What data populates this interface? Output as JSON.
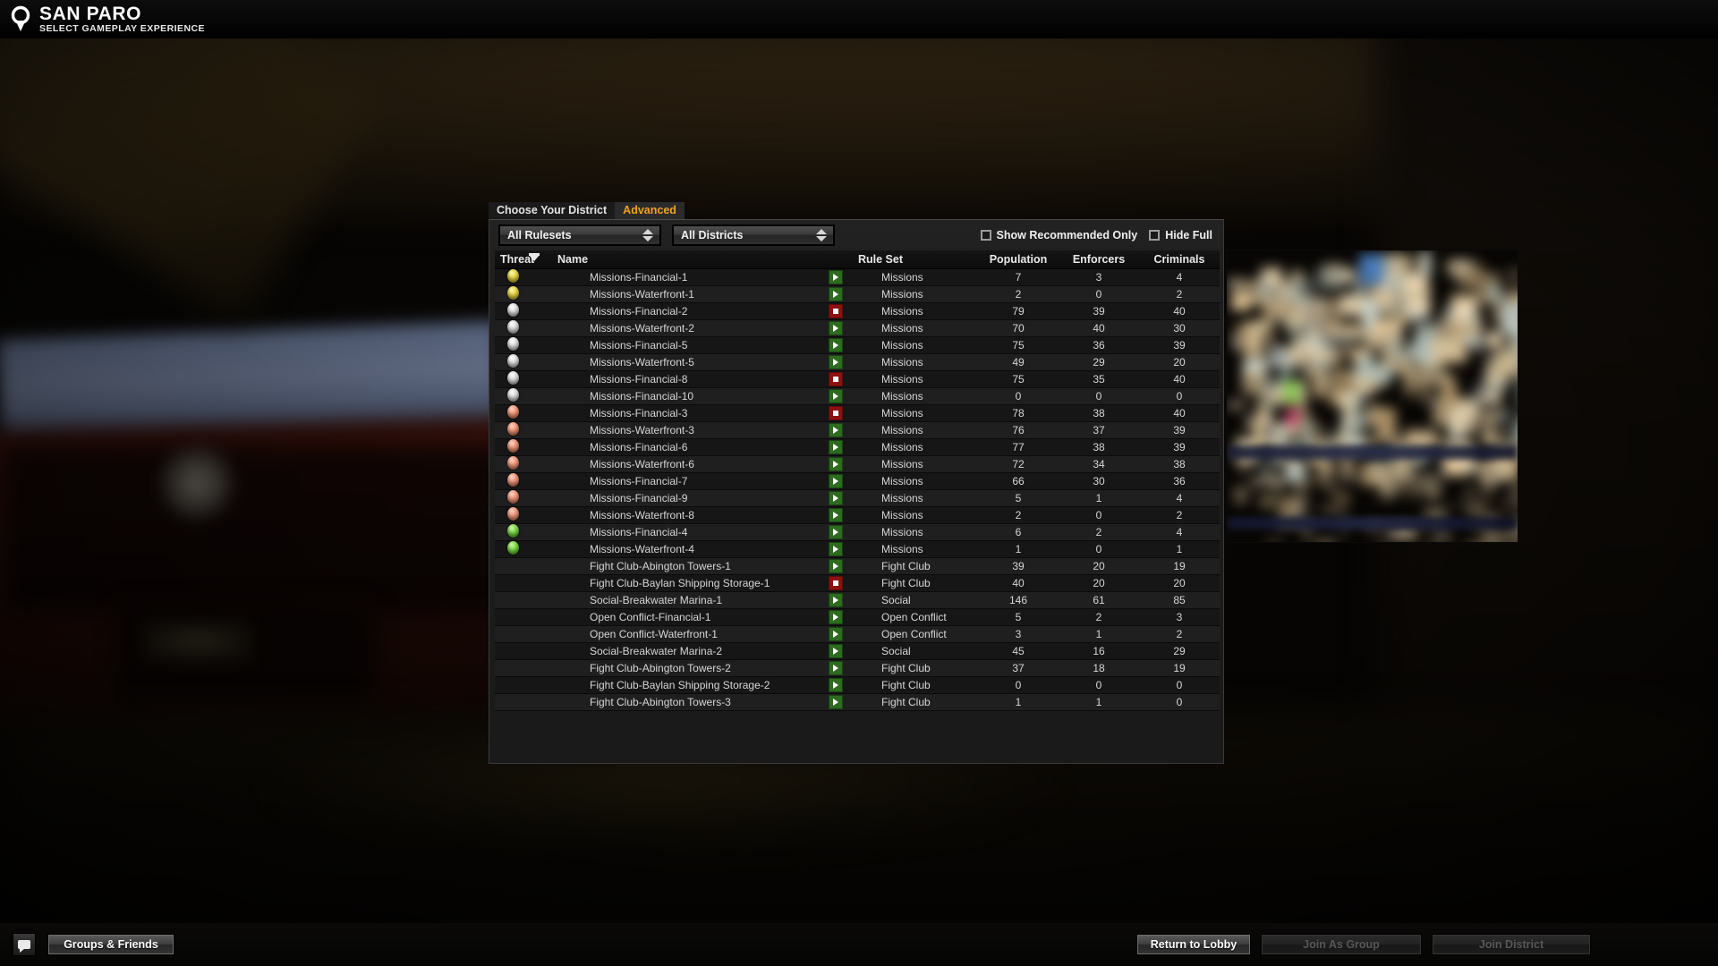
{
  "header": {
    "logo_icon": "magnifier-pin-icon",
    "title": "SAN PARO",
    "subtitle": "SELECT GAMEPLAY EXPERIENCE"
  },
  "panel": {
    "tabs": [
      {
        "label": "Choose Your District",
        "active": false
      },
      {
        "label": "Advanced",
        "active": true
      }
    ],
    "filters": {
      "ruleset_dropdown": {
        "name": "ruleset-filter",
        "value": "All Rulesets"
      },
      "district_dropdown": {
        "name": "district-filter",
        "value": "All Districts"
      }
    },
    "checkboxes": [
      {
        "label": "Show Recommended Only",
        "checked": false
      },
      {
        "label": "Hide Full",
        "checked": false
      }
    ],
    "table": {
      "columns": [
        "Threat",
        "Name",
        "",
        "Rule Set",
        "Population",
        "Enforcers",
        "Criminals"
      ],
      "sort_column": "Threat",
      "sort_direction": "descending",
      "rows": [
        {
          "threat": "gold",
          "name": "Missions-Financial-1",
          "status": "open",
          "rule_set": "Missions",
          "population": "7",
          "enforcers": "3",
          "criminals": "4"
        },
        {
          "threat": "gold",
          "name": "Missions-Waterfront-1",
          "status": "open",
          "rule_set": "Missions",
          "population": "2",
          "enforcers": "0",
          "criminals": "2"
        },
        {
          "threat": "silver",
          "name": "Missions-Financial-2",
          "status": "full",
          "rule_set": "Missions",
          "population": "79",
          "enforcers": "39",
          "criminals": "40"
        },
        {
          "threat": "silver",
          "name": "Missions-Waterfront-2",
          "status": "open",
          "rule_set": "Missions",
          "population": "70",
          "enforcers": "40",
          "criminals": "30"
        },
        {
          "threat": "silver",
          "name": "Missions-Financial-5",
          "status": "open",
          "rule_set": "Missions",
          "population": "75",
          "enforcers": "36",
          "criminals": "39"
        },
        {
          "threat": "silver",
          "name": "Missions-Waterfront-5",
          "status": "open",
          "rule_set": "Missions",
          "population": "49",
          "enforcers": "29",
          "criminals": "20"
        },
        {
          "threat": "silver",
          "name": "Missions-Financial-8",
          "status": "full",
          "rule_set": "Missions",
          "population": "75",
          "enforcers": "35",
          "criminals": "40"
        },
        {
          "threat": "silver",
          "name": "Missions-Financial-10",
          "status": "open",
          "rule_set": "Missions",
          "population": "0",
          "enforcers": "0",
          "criminals": "0"
        },
        {
          "threat": "salmon",
          "name": "Missions-Financial-3",
          "status": "full",
          "rule_set": "Missions",
          "population": "78",
          "enforcers": "38",
          "criminals": "40"
        },
        {
          "threat": "salmon",
          "name": "Missions-Waterfront-3",
          "status": "open",
          "rule_set": "Missions",
          "population": "76",
          "enforcers": "37",
          "criminals": "39"
        },
        {
          "threat": "salmon",
          "name": "Missions-Financial-6",
          "status": "open",
          "rule_set": "Missions",
          "population": "77",
          "enforcers": "38",
          "criminals": "39"
        },
        {
          "threat": "salmon",
          "name": "Missions-Waterfront-6",
          "status": "open",
          "rule_set": "Missions",
          "population": "72",
          "enforcers": "34",
          "criminals": "38"
        },
        {
          "threat": "salmon",
          "name": "Missions-Financial-7",
          "status": "open",
          "rule_set": "Missions",
          "population": "66",
          "enforcers": "30",
          "criminals": "36"
        },
        {
          "threat": "salmon",
          "name": "Missions-Financial-9",
          "status": "open",
          "rule_set": "Missions",
          "population": "5",
          "enforcers": "1",
          "criminals": "4"
        },
        {
          "threat": "salmon",
          "name": "Missions-Waterfront-8",
          "status": "open",
          "rule_set": "Missions",
          "population": "2",
          "enforcers": "0",
          "criminals": "2"
        },
        {
          "threat": "green",
          "name": "Missions-Financial-4",
          "status": "open",
          "rule_set": "Missions",
          "population": "6",
          "enforcers": "2",
          "criminals": "4"
        },
        {
          "threat": "green",
          "name": "Missions-Waterfront-4",
          "status": "open",
          "rule_set": "Missions",
          "population": "1",
          "enforcers": "0",
          "criminals": "1"
        },
        {
          "threat": "none",
          "name": "Fight Club-Abington Towers-1",
          "status": "open",
          "rule_set": "Fight Club",
          "population": "39",
          "enforcers": "20",
          "criminals": "19"
        },
        {
          "threat": "none",
          "name": "Fight Club-Baylan Shipping Storage-1",
          "status": "full",
          "rule_set": "Fight Club",
          "population": "40",
          "enforcers": "20",
          "criminals": "20"
        },
        {
          "threat": "none",
          "name": "Social-Breakwater Marina-1",
          "status": "open",
          "rule_set": "Social",
          "population": "146",
          "enforcers": "61",
          "criminals": "85"
        },
        {
          "threat": "none",
          "name": "Open Conflict-Financial-1",
          "status": "open",
          "rule_set": "Open Conflict",
          "population": "5",
          "enforcers": "2",
          "criminals": "3"
        },
        {
          "threat": "none",
          "name": "Open Conflict-Waterfront-1",
          "status": "open",
          "rule_set": "Open Conflict",
          "population": "3",
          "enforcers": "1",
          "criminals": "2"
        },
        {
          "threat": "none",
          "name": "Social-Breakwater Marina-2",
          "status": "open",
          "rule_set": "Social",
          "population": "45",
          "enforcers": "16",
          "criminals": "29"
        },
        {
          "threat": "none",
          "name": "Fight Club-Abington Towers-2",
          "status": "open",
          "rule_set": "Fight Club",
          "population": "37",
          "enforcers": "18",
          "criminals": "19"
        },
        {
          "threat": "none",
          "name": "Fight Club-Baylan Shipping Storage-2",
          "status": "open",
          "rule_set": "Fight Club",
          "population": "0",
          "enforcers": "0",
          "criminals": "0"
        },
        {
          "threat": "none",
          "name": "Fight Club-Abington Towers-3",
          "status": "open",
          "rule_set": "Fight Club",
          "population": "1",
          "enforcers": "1",
          "criminals": "0"
        }
      ]
    }
  },
  "preview": {
    "name": "district-preview-image",
    "description": "blurred city night preview"
  },
  "bottombar": {
    "chat_icon": "chat-bubble-icon",
    "groups_button": {
      "label": "Groups & Friends",
      "enabled": true
    },
    "return_button": {
      "label": "Return to Lobby",
      "enabled": true
    },
    "join_group_button": {
      "label": "Join As Group",
      "enabled": false
    },
    "join_district_button": {
      "label": "Join District",
      "enabled": false
    }
  },
  "colors": {
    "accent_orange": "#f3a11c",
    "status_open_green": "#2d6b1f",
    "status_full_red": "#8d1111",
    "threat_gold": "#e8d94a",
    "threat_silver": "#e0e0e0",
    "threat_salmon": "#ef9a7e",
    "threat_green": "#7ed94a"
  }
}
